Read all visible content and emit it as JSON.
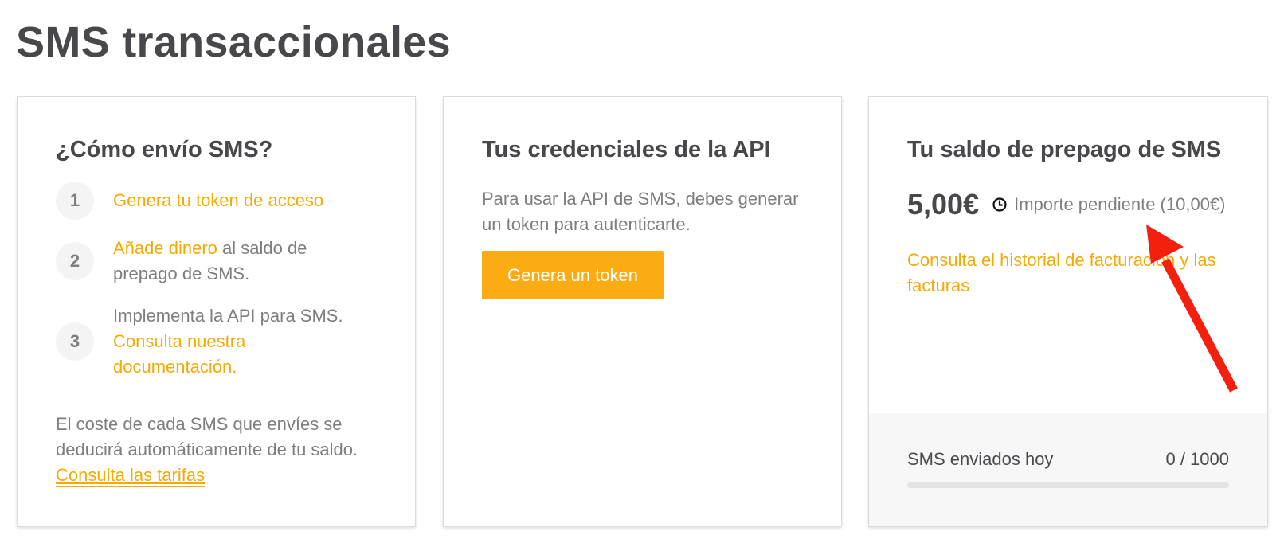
{
  "page": {
    "title": "SMS transaccionales"
  },
  "how_card": {
    "title": "¿Cómo envío SMS?",
    "steps": [
      {
        "number": "1",
        "link": "Genera tu token de acceso",
        "text": ""
      },
      {
        "number": "2",
        "link": "Añade dinero",
        "text": " al saldo de prepago de SMS."
      },
      {
        "number": "3",
        "text": "Implementa la API para SMS. ",
        "link": "Consulta nuestra documentación."
      }
    ],
    "cost_note": "El coste de cada SMS que envíes se deducirá automáticamente de tu saldo. ",
    "tariffs_link": "Consulta las tarifas"
  },
  "api_card": {
    "title": "Tus credenciales de la API",
    "description": "Para usar la API de SMS, debes generar un token para autenticarte.",
    "button_label": "Genera un token"
  },
  "balance_card": {
    "title": "Tu saldo de prepago de SMS",
    "balance": "5,00€",
    "pending": "Importe pendiente (10,00€)",
    "billing_link": "Consulta el historial de facturación y las facturas",
    "usage": {
      "label": "SMS enviados hoy",
      "count": "0 / 1000",
      "sent": 0,
      "limit": 1000
    }
  },
  "colors": {
    "accent": "#fcac13",
    "link": "#f8a900",
    "annotation_arrow": "#f41f0c"
  },
  "icons": {
    "pending": "clock-icon",
    "annotation": "red-arrow-icon"
  }
}
